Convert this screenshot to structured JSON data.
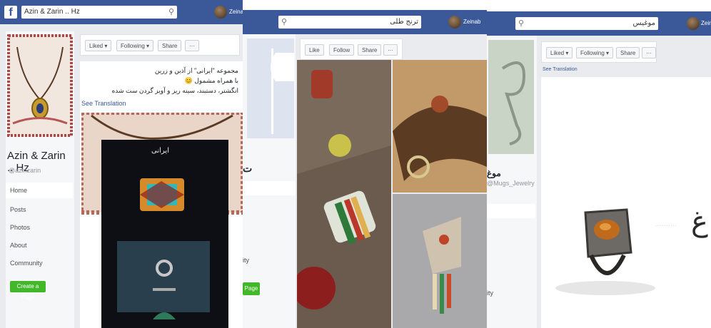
{
  "panel1": {
    "search_value": "Azin & Zarin .. Hz",
    "user": "Zeinab",
    "page_name": "Azin & Zarin .. Hz",
    "handle": "@azinzarin",
    "nav": [
      "Home",
      "Posts",
      "Photos",
      "About",
      "Community"
    ],
    "create_page": "Create a Page",
    "actions": [
      "Liked ▾",
      "Following ▾",
      "Share",
      "···"
    ],
    "post_lines": [
      "مجموعه \"ایرانی\" از آذین و زرین",
      "با همراه مشمول 😊",
      "انگشتر، دستبند، سینه ریز و آویز گردن ست شده"
    ],
    "see_translation": "See Translation",
    "product_title": "ایرانی"
  },
  "panel2": {
    "search_value": "ترنج طلی",
    "user": "Zeinab",
    "actions": [
      "Like",
      "Follow",
      "Share",
      "···"
    ],
    "sidebar_text": "ت",
    "sidebar_small": "ity",
    "create_page": "Page"
  },
  "panel3": {
    "search_value": "موغیس",
    "user": "Zeina",
    "page_name": "موغ",
    "handle": "@Mugs_Jewelry",
    "sidebar_small": "ity",
    "actions": [
      "Liked ▾",
      "Following ▾",
      "Share",
      "···"
    ],
    "see_translation": "See Translation",
    "logo_char": "غ"
  },
  "colors": {
    "facebook_blue": "#3b5998",
    "create_green": "#42b72a",
    "page_bg": "#e9ebee"
  }
}
